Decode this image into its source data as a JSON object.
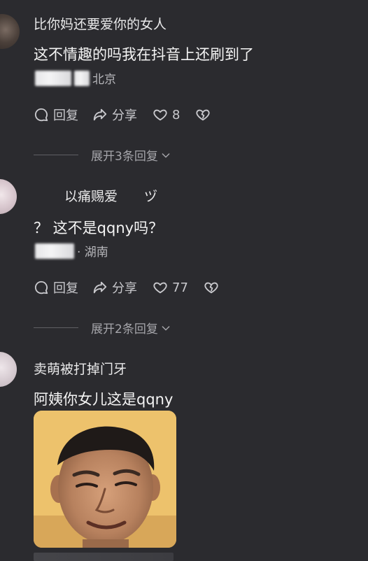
{
  "comments": [
    {
      "username": "比你妈还要爱你的女人",
      "text": "这不情趣的吗我在抖音上还刷到了",
      "location": "北京",
      "reply_label": "回复",
      "share_label": "分享",
      "like_count": "8",
      "expand_replies": "展开3条回复"
    },
    {
      "username": "以痛赐爱　　ヅ",
      "text": "？ 这不是qqny吗？",
      "location": "· 湖南",
      "reply_label": "回复",
      "share_label": "分享",
      "like_count": "77",
      "expand_replies": "展开2条回复"
    },
    {
      "username": "卖萌被打掉门牙",
      "text": "阿姨你女儿这是qqny"
    }
  ],
  "icons": {
    "reply": "comment-bubble-icon",
    "share": "share-arrow-icon",
    "like": "heart-icon",
    "dislike": "broken-heart-icon",
    "expand": "chevron-down-icon"
  },
  "colors": {
    "background": "#2b2b2f",
    "text_primary": "#f4f4f4",
    "text_secondary": "#b7b7bb"
  }
}
